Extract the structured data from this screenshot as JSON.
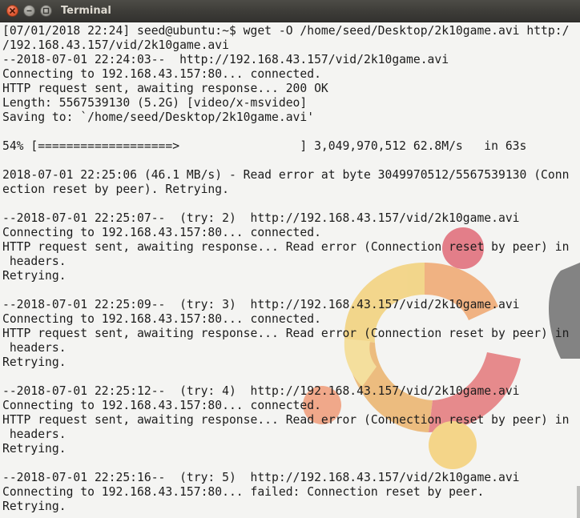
{
  "window": {
    "title": "Terminal",
    "colors": {
      "titlebar": "#3d3c38",
      "title_text": "#dfdbd2",
      "close_button": "#e8633e",
      "terminal_background": "#f4f4f2",
      "terminal_text": "#1c1c1c"
    },
    "buttons": {
      "close_icon": "close-icon",
      "minimize_icon": "minimize-icon",
      "maximize_icon": "maximize-icon"
    }
  },
  "terminal": {
    "lines": [
      "[07/01/2018 22:24] seed@ubuntu:~$ wget -O /home/seed/Desktop/2k10game.avi http:/",
      "/192.168.43.157/vid/2k10game.avi",
      "--2018-07-01 22:24:03--  http://192.168.43.157/vid/2k10game.avi",
      "Connecting to 192.168.43.157:80... connected.",
      "HTTP request sent, awaiting response... 200 OK",
      "Length: 5567539130 (5.2G) [video/x-msvideo]",
      "Saving to: `/home/seed/Desktop/2k10game.avi'",
      "",
      "54% [===================>                 ] 3,049,970,512 62.8M/s   in 63s",
      "",
      "2018-07-01 22:25:06 (46.1 MB/s) - Read error at byte 3049970512/5567539130 (Conn",
      "ection reset by peer). Retrying.",
      "",
      "--2018-07-01 22:25:07--  (try: 2)  http://192.168.43.157/vid/2k10game.avi",
      "Connecting to 192.168.43.157:80... connected.",
      "HTTP request sent, awaiting response... Read error (Connection reset by peer) in",
      " headers.",
      "Retrying.",
      "",
      "--2018-07-01 22:25:09--  (try: 3)  http://192.168.43.157/vid/2k10game.avi",
      "Connecting to 192.168.43.157:80... connected.",
      "HTTP request sent, awaiting response... Read error (Connection reset by peer) in",
      " headers.",
      "Retrying.",
      "",
      "--2018-07-01 22:25:12--  (try: 4)  http://192.168.43.157/vid/2k10game.avi",
      "Connecting to 192.168.43.157:80... connected.",
      "HTTP request sent, awaiting response... Read error (Connection reset by peer) in",
      " headers.",
      "Retrying.",
      "",
      "--2018-07-01 22:25:16--  (try: 5)  http://192.168.43.157/vid/2k10game.avi",
      "Connecting to 192.168.43.157:80... failed: Connection reset by peer.",
      "Retrying."
    ]
  }
}
